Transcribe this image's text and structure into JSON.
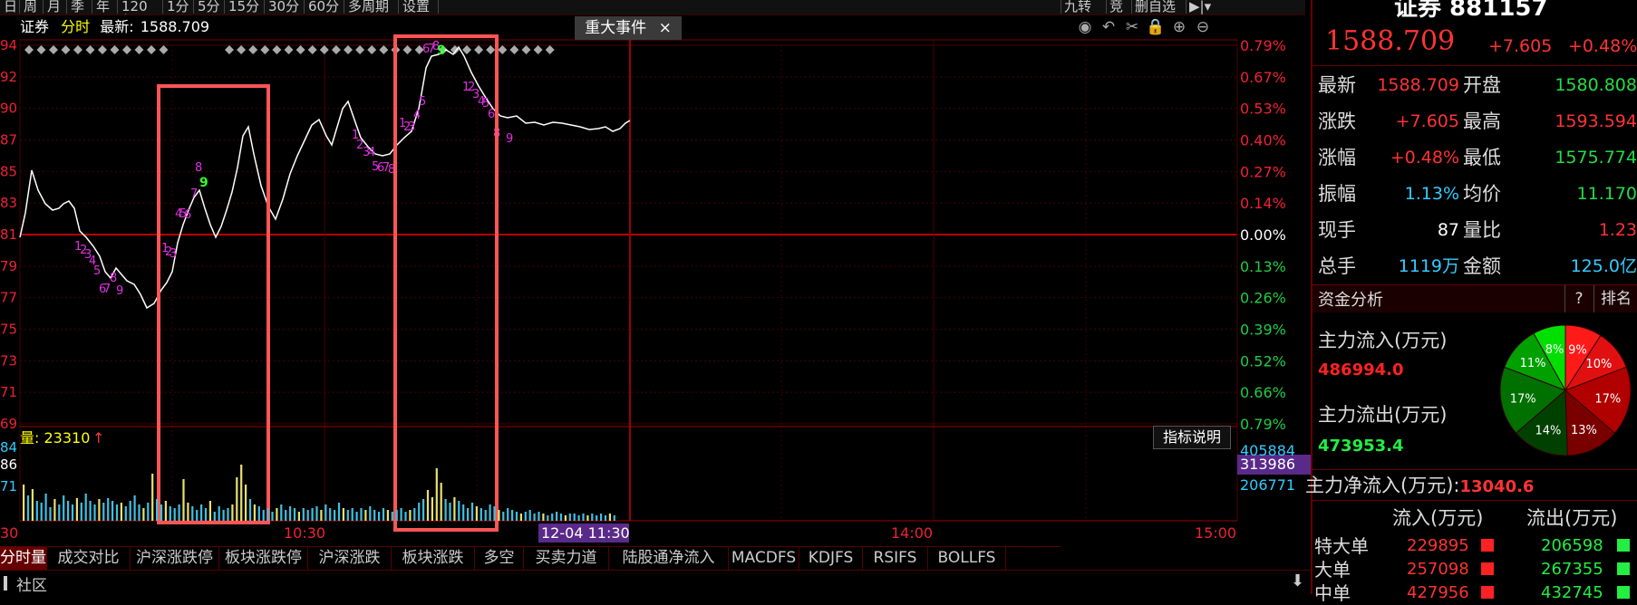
{
  "period_bar": [
    "日",
    "周",
    "月",
    "季",
    "年",
    "120年",
    "1分",
    "5分",
    "15分",
    "30分",
    "60分",
    "多周期",
    "设置"
  ],
  "right_tools": [
    "九转",
    "竞",
    "删自选",
    "▶|▾"
  ],
  "header": {
    "name": "证券",
    "mode": "分时",
    "latest_label": "最新:",
    "latest_value": "1588.709",
    "events_tab": "重大事件",
    "close_glyph": "×",
    "indicator_help": "指标说明"
  },
  "toolbar_icons": [
    "eye-icon",
    "undo-icon",
    "scissors-icon",
    "lock-icon",
    "zoom-in-icon",
    "zoom-out-icon"
  ],
  "toolbar_glyphs": [
    "◉",
    "↶",
    "✂",
    "🔒",
    "⊕",
    "⊖"
  ],
  "left_axis": [
    "94",
    "92",
    "90",
    "87",
    "85",
    "83",
    "81",
    "79",
    "77",
    "75",
    "73",
    "71",
    "69"
  ],
  "right_axis": [
    {
      "label": "0.79%",
      "color": "#e23"
    },
    {
      "label": "0.67%",
      "color": "#e23"
    },
    {
      "label": "0.53%",
      "color": "#e23"
    },
    {
      "label": "0.40%",
      "color": "#e23"
    },
    {
      "label": "0.27%",
      "color": "#e23"
    },
    {
      "label": "0.14%",
      "color": "#e23"
    },
    {
      "label": "0.00%",
      "color": "#fff"
    },
    {
      "label": "0.13%",
      "color": "#2c4"
    },
    {
      "label": "0.26%",
      "color": "#2c4"
    },
    {
      "label": "0.39%",
      "color": "#2c4"
    },
    {
      "label": "0.52%",
      "color": "#2c4"
    },
    {
      "label": "0.66%",
      "color": "#2c4"
    },
    {
      "label": "0.79%",
      "color": "#2c4"
    }
  ],
  "volume": {
    "label": "量: 23310",
    "arrow": "↑",
    "left_ticks": [
      "84",
      "86",
      "71"
    ],
    "right_ticks": [
      "405884",
      "313986",
      "206771"
    ]
  },
  "time_axis": {
    "start": "30",
    "t1030": "10:30",
    "cursor": "12-04 11:30",
    "t1400": "14:00",
    "t1500": "15:00"
  },
  "bottom_tabs": [
    "分时量",
    "成交对比",
    "沪深涨跌停",
    "板块涨跌停",
    "沪深涨跌",
    "板块涨跌",
    "多空",
    "买卖力道",
    "陆股通净流入",
    "MACDFS",
    "KDJFS",
    "RSIFS",
    "BOLLFS"
  ],
  "bottom_bar": {
    "label": "社区"
  },
  "right_panel": {
    "title": "证券 881157",
    "price": "1588.709",
    "change": "+7.605",
    "change_pct": "+0.48%",
    "quote_rows": [
      {
        "l1": "最新",
        "v1": "1588.709",
        "c1": "#f33",
        "l2": "开盘",
        "v2": "1580.808",
        "c2": "#2d4"
      },
      {
        "l1": "涨跌",
        "v1": "+7.605",
        "c1": "#f33",
        "l2": "最高",
        "v2": "1593.594",
        "c2": "#f33"
      },
      {
        "l1": "涨幅",
        "v1": "+0.48%",
        "c1": "#f33",
        "l2": "最低",
        "v2": "1575.774",
        "c2": "#2d4"
      },
      {
        "l1": "振幅",
        "v1": "1.13%",
        "c1": "#3cf",
        "l2": "均价",
        "v2": "11.170",
        "c2": "#2d4"
      },
      {
        "l1": "现手",
        "v1": "87",
        "c1": "#fff",
        "l2": "量比",
        "v2": "1.23",
        "c2": "#f33"
      },
      {
        "l1": "总手",
        "v1": "1119万",
        "c1": "#3cf",
        "l2": "金额",
        "v2": "125.0亿",
        "c2": "#3cf"
      }
    ],
    "fund_title": "资金分析",
    "fund_help": "?",
    "fund_rank": "排名",
    "main_in_label": "主力流入(万元)",
    "main_in_value": "486994.0",
    "main_out_label": "主力流出(万元)",
    "main_out_value": "473953.4",
    "net_label": "主力净流入(万元):",
    "net_value": "13040.6",
    "flow_header_in": "流入(万元)",
    "flow_header_out": "流出(万元)",
    "flow_rows": [
      {
        "name": "特大单",
        "in": "229895",
        "out": "206598"
      },
      {
        "name": "大单",
        "in": "257098",
        "out": "267355"
      },
      {
        "name": "中单",
        "in": "427956",
        "out": "432745"
      }
    ]
  },
  "pie": {
    "slices": [
      {
        "label": "9%",
        "value": 9,
        "color": "#ff1a1a"
      },
      {
        "label": "10%",
        "value": 10,
        "color": "#e01010"
      },
      {
        "label": "17%",
        "value": 17,
        "color": "#b00000"
      },
      {
        "label": "13%",
        "value": 13,
        "color": "#7a0000"
      },
      {
        "label": "14%",
        "value": 14,
        "color": "#004000"
      },
      {
        "label": "17%",
        "value": 17,
        "color": "#007000"
      },
      {
        "label": "11%",
        "value": 11,
        "color": "#00a000"
      },
      {
        "label": "8%",
        "value": 8,
        "color": "#00e000"
      }
    ]
  }
}
